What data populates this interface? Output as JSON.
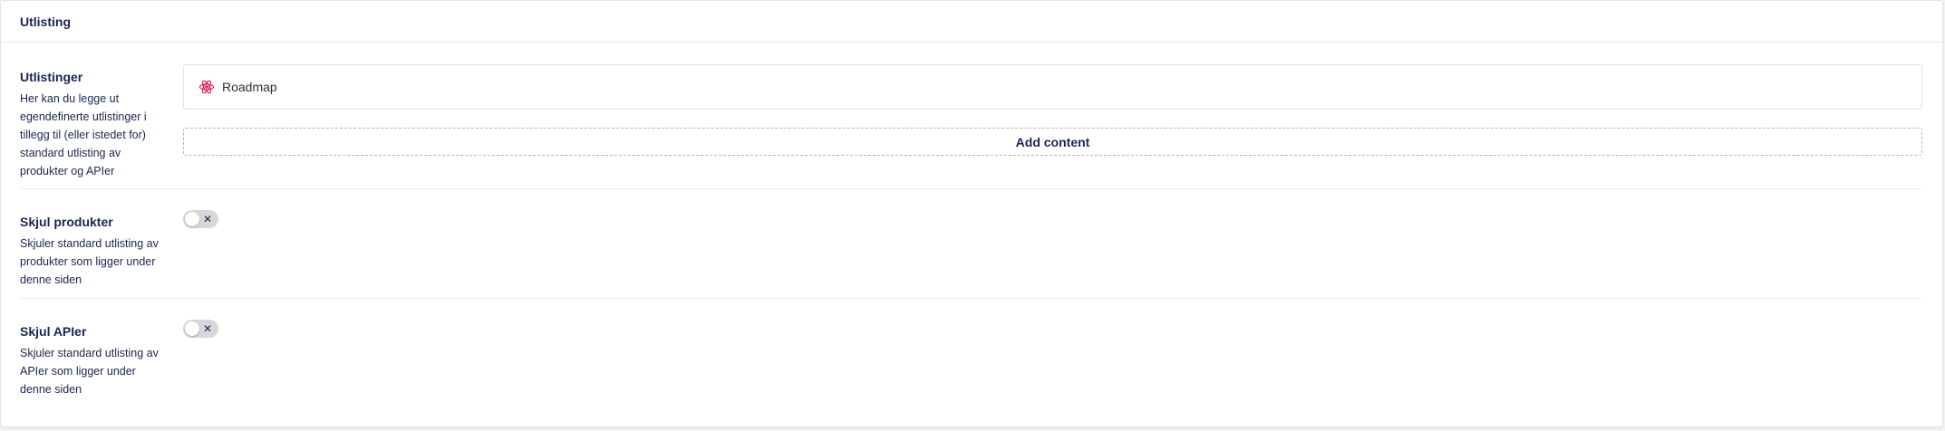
{
  "panel": {
    "header_title": "Utlisting"
  },
  "fields": [
    {
      "title": "Utlistinger",
      "description": "Her kan du legge ut egendefinerte utlistinger i tillegg til (eller istedet for) standard utlisting av produkter og APIer",
      "blocks": [
        {
          "name": "Roadmap",
          "icon": "atom-icon"
        }
      ],
      "add_label": "Add content"
    },
    {
      "title": "Skjul produkter",
      "description": "Skjuler standard utlisting av produkter som ligger under denne siden",
      "toggle": {
        "on": false,
        "off_glyph": "✕"
      }
    },
    {
      "title": "Skjul APIer",
      "description": "Skjuler standard utlisting av APIer som ligger under denne siden",
      "toggle": {
        "on": false,
        "off_glyph": "✕"
      }
    }
  ],
  "colors": {
    "text": "#1b264f",
    "icon_accent": "#e0245e",
    "toggle_off": "#d8d7d9"
  }
}
